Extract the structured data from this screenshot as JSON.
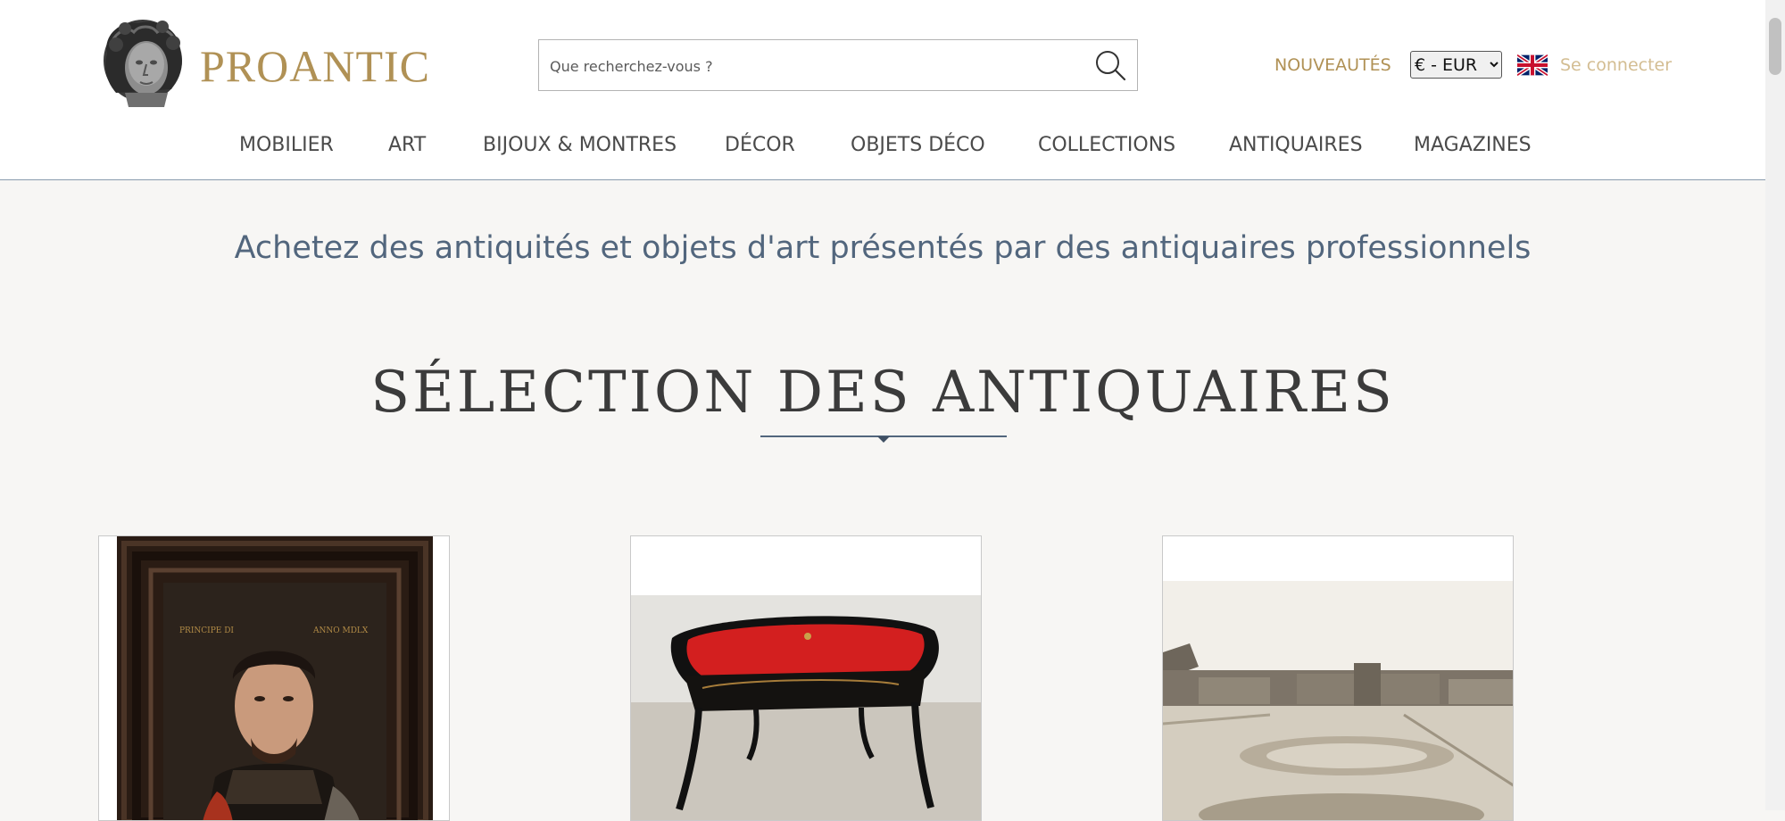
{
  "header": {
    "logo_text": "PROANTIC",
    "search": {
      "placeholder": "Que recherchez-vous ?"
    },
    "nouveautes_label": "NOUVEAUTÉS",
    "currency_selected": "€ - EUR",
    "language_icon": "uk-flag-icon",
    "login_label": "Se connecter"
  },
  "nav": {
    "items": [
      {
        "label": "MOBILIER"
      },
      {
        "label": "ART"
      },
      {
        "label": "BIJOUX & MONTRES"
      },
      {
        "label": "DÉCOR"
      },
      {
        "label": "OBJETS DÉCO"
      },
      {
        "label": "COLLECTIONS"
      },
      {
        "label": "ANTIQUAIRES"
      },
      {
        "label": "MAGAZINES"
      }
    ]
  },
  "main": {
    "tagline": "Achetez des antiquités et objets d'art présentés par des antiquaires professionnels",
    "section_title": "SÉLECTION DES ANTIQUAIRES"
  },
  "products": [
    {
      "image": "framed-portrait-painting"
    },
    {
      "image": "red-top-lacquered-desk"
    },
    {
      "image": "sepia-photograph-louvre-tuileries"
    }
  ],
  "colors": {
    "brand_gold": "#b09155",
    "login_gold": "#d3bd92",
    "tagline_blue": "#52667d",
    "background": "#f7f6f4"
  }
}
